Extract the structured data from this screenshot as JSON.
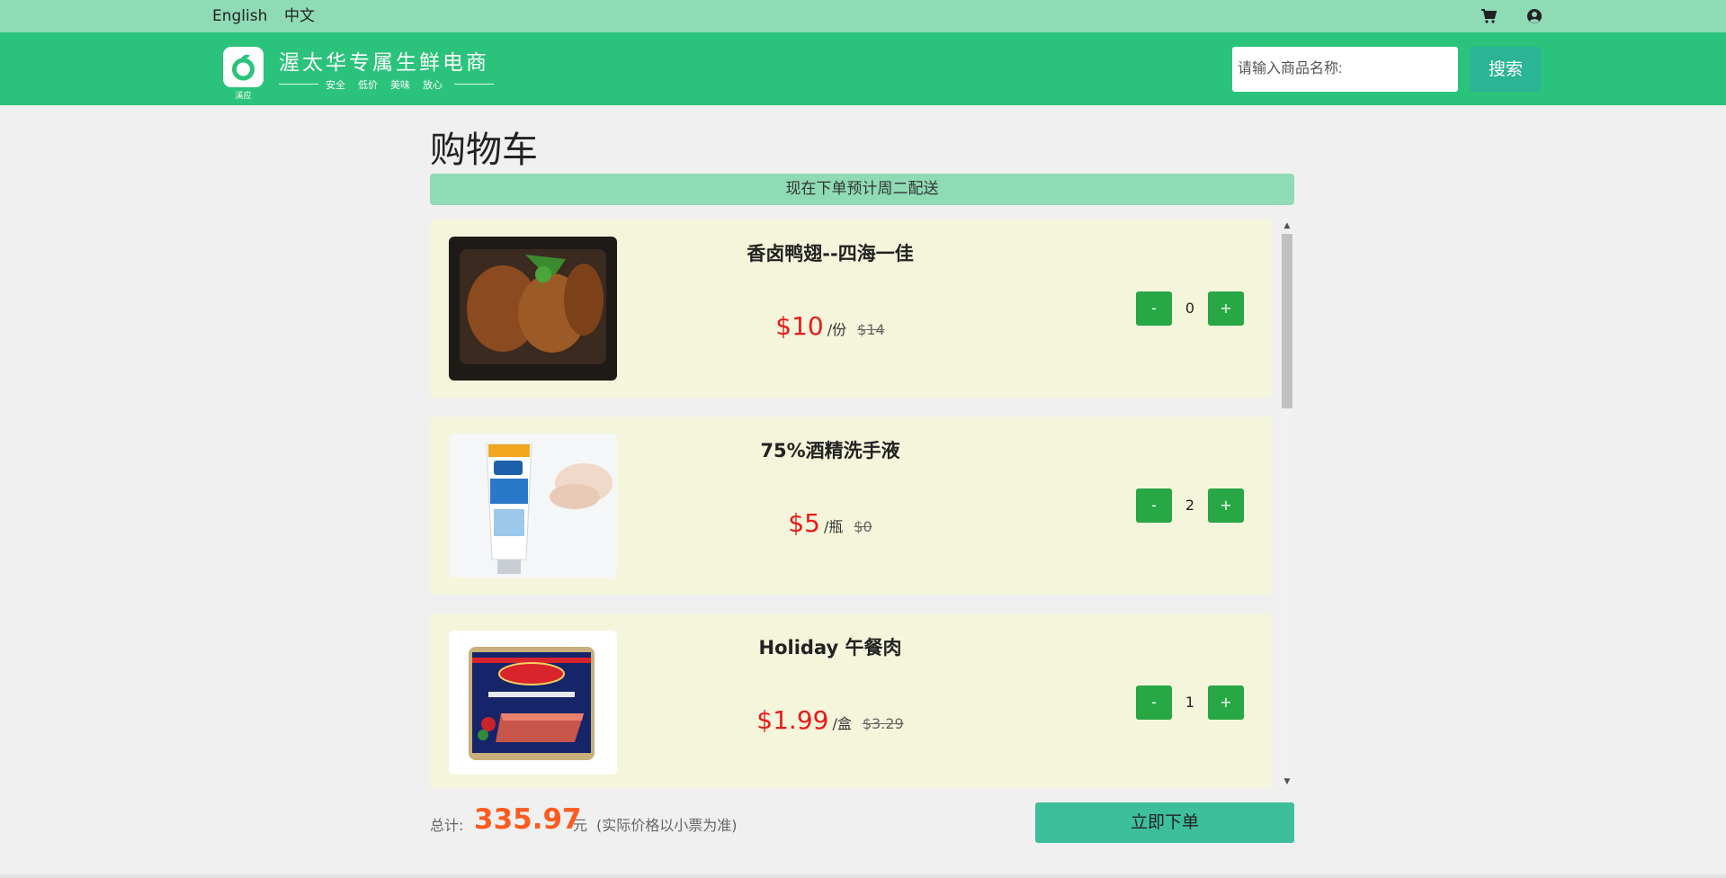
{
  "topbar": {
    "lang_en": "English",
    "lang_zh": "中文",
    "cart_icon": "cart-icon",
    "user_icon": "user-circle-icon"
  },
  "header": {
    "logo_sub": "溪应",
    "brand_title": "渥太华专属生鲜电商",
    "tags": [
      "安全",
      "低价",
      "美味",
      "放心"
    ],
    "search_placeholder": "请输入商品名称:",
    "search_button": "搜索"
  },
  "page": {
    "title": "购物车",
    "notice": "现在下单预计周二配送"
  },
  "cart": {
    "items": [
      {
        "name": "香卤鸭翅--四海一佳",
        "price": "$10",
        "unit": "/份",
        "old_price": "$14",
        "minus": "-",
        "qty": "0",
        "plus": "+"
      },
      {
        "name": "75%酒精洗手液",
        "price": "$5",
        "unit": "/瓶",
        "old_price": "$0",
        "minus": "-",
        "qty": "2",
        "plus": "+"
      },
      {
        "name": "Holiday 午餐肉",
        "price": "$1.99",
        "unit": "/盒",
        "old_price": "$3.29",
        "minus": "-",
        "qty": "1",
        "plus": "+"
      }
    ]
  },
  "footer": {
    "total_label": "总计:",
    "total_value": "335.97",
    "total_unit": "元",
    "total_note": "(实际价格以小票为准)",
    "order_button": "立即下单"
  },
  "colors": {
    "topbar": "#8edbb6",
    "header": "#2bc37b",
    "search_button": "#2bb594",
    "item_bg": "#f5f5dc",
    "qty_button": "#28a745",
    "price": "#e81a1a",
    "total": "#ff5a1f",
    "order_button": "#3ebf9b"
  }
}
